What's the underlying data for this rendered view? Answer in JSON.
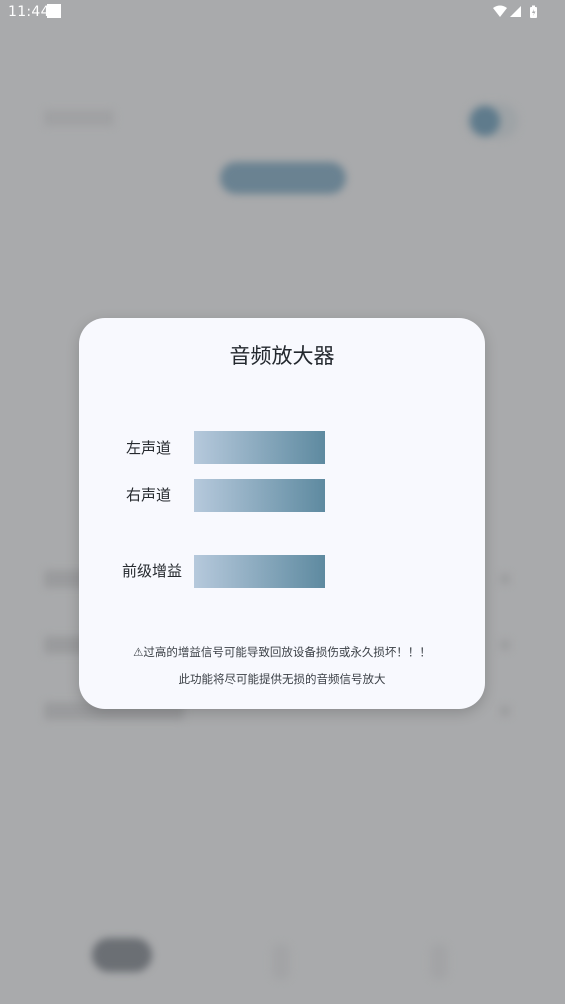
{
  "status_bar": {
    "time": "11:44"
  },
  "dialog": {
    "title": "音频放大器",
    "sliders": [
      {
        "label": "左声道",
        "level": 1.0
      },
      {
        "label": "右声道",
        "level": 1.0
      },
      {
        "label": "前级增益",
        "level": 1.0
      }
    ],
    "warning": "⚠过高的增益信号可能导致回放设备损伤或永久损坏！！！",
    "note": "此功能将尽可能提供无损的音频信号放大"
  },
  "colors": {
    "slider_start": "#b6c9dc",
    "slider_end": "#5e8aa0",
    "dialog_background": "#f8f9fe",
    "scrim": "#a9aaac"
  }
}
